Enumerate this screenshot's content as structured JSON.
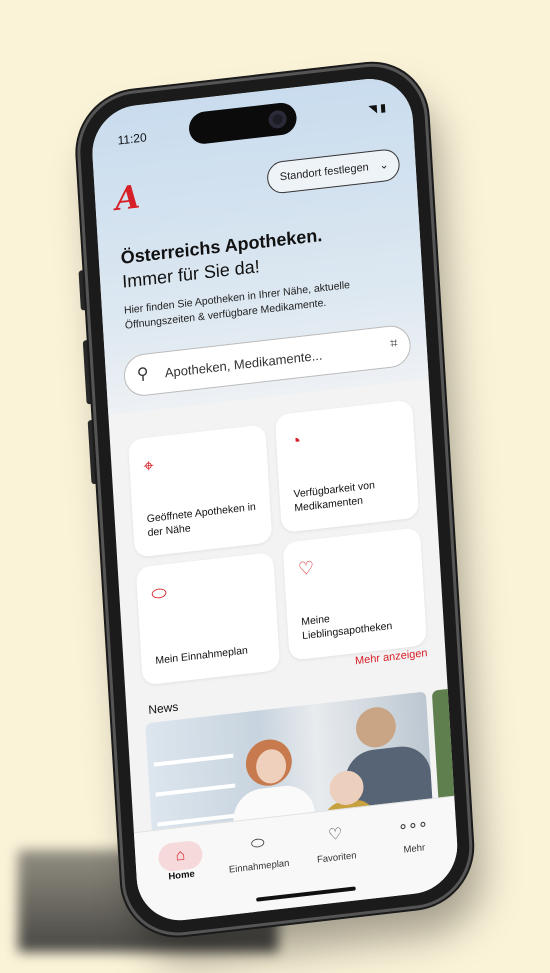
{
  "status": {
    "time": "11:20",
    "icons": "◥ ▮"
  },
  "brand": {
    "logo": "A",
    "color": "#d61f26"
  },
  "header": {
    "location_button": "Standort festlegen"
  },
  "hero": {
    "title": "Österreichs Apotheken.",
    "subtitle": "Immer für Sie da!",
    "description": "Hier finden Sie Apotheken in Ihrer Nähe, aktuelle Öffnungszeiten & verfügbare Medikamente."
  },
  "search": {
    "placeholder": "Apotheken, Medikamente..."
  },
  "tiles": [
    {
      "icon": "location-pin-icon",
      "glyph": "⌖",
      "label": "Geöffnete Apotheken in der Nähe"
    },
    {
      "icon": "availability-clock-icon",
      "glyph": "◔",
      "label": "Verfügbarkeit von Medikamenten"
    },
    {
      "icon": "pill-icon",
      "glyph": "⬭",
      "label": "Mein Einnahmeplan"
    },
    {
      "icon": "heart-icon",
      "glyph": "♡",
      "label": "Meine Lieblingsapotheken"
    }
  ],
  "news": {
    "heading": "News",
    "more": "Mehr anzeigen"
  },
  "tabbar": [
    {
      "icon": "home-icon",
      "glyph": "⌂",
      "label": "Home",
      "active": true
    },
    {
      "icon": "pill-icon",
      "glyph": "⬭",
      "label": "Einnahmeplan",
      "active": false
    },
    {
      "icon": "heart-icon",
      "glyph": "♡",
      "label": "Favoriten",
      "active": false
    },
    {
      "icon": "more-icon",
      "glyph": "∘∘∘",
      "label": "Mehr",
      "active": false
    }
  ]
}
